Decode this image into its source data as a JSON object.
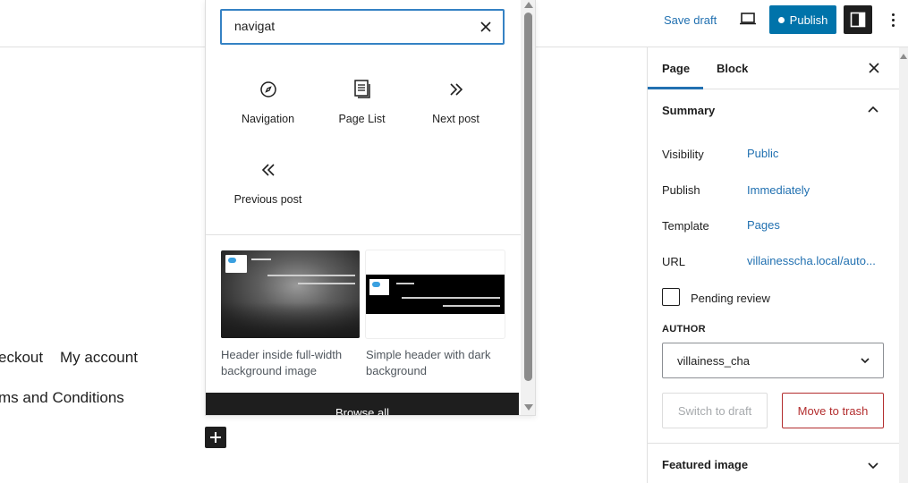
{
  "topbar": {
    "save_draft": "Save draft",
    "publish": "Publish"
  },
  "canvas": {
    "nav_line_1_left": "eckout",
    "nav_line_1_right": "My account",
    "nav_line_2": "ms and Conditions"
  },
  "inserter": {
    "search_value": "navigat",
    "blocks": [
      {
        "label": "Navigation",
        "icon": "compass-icon"
      },
      {
        "label": "Page List",
        "icon": "page-list-icon"
      },
      {
        "label": "Next post",
        "icon": "double-chevron-right-icon"
      },
      {
        "label": "Previous post",
        "icon": "double-chevron-left-icon"
      }
    ],
    "patterns": [
      {
        "label": "Header inside full-width background image"
      },
      {
        "label": "Simple header with dark background"
      }
    ],
    "browse_all": "Browse all"
  },
  "sidebar": {
    "tabs": [
      "Page",
      "Block"
    ],
    "summary_title": "Summary",
    "rows": [
      {
        "label": "Visibility",
        "value": "Public"
      },
      {
        "label": "Publish",
        "value": "Immediately"
      },
      {
        "label": "Template",
        "value": "Pages"
      },
      {
        "label": "URL",
        "value": "villainesscha.local/auto..."
      }
    ],
    "pending_review": "Pending review",
    "author_label": "AUTHOR",
    "author_value": "villainess_cha",
    "switch_to_draft": "Switch to draft",
    "move_to_trash": "Move to trash",
    "featured_image": "Featured image"
  },
  "colors": {
    "accent": "#2271b1",
    "publish": "#0073aa",
    "danger": "#b32d2e"
  }
}
